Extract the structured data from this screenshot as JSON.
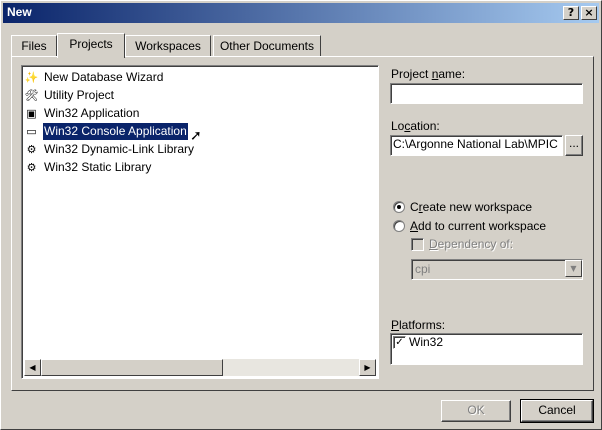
{
  "window": {
    "title": "New",
    "help_glyph": "?",
    "close_glyph": "×"
  },
  "tabs": [
    {
      "label": "Files",
      "active": false
    },
    {
      "label": "Projects",
      "active": true
    },
    {
      "label": "Workspaces",
      "active": false
    },
    {
      "label": "Other Documents",
      "active": false
    }
  ],
  "project_types": [
    {
      "label": "New Database Wizard",
      "icon": "wand-icon",
      "glyph": "✨",
      "selected": false
    },
    {
      "label": "Utility Project",
      "icon": "tools-icon",
      "glyph": "🛠",
      "selected": false
    },
    {
      "label": "Win32 Application",
      "icon": "window-app-icon",
      "glyph": "▣",
      "selected": false
    },
    {
      "label": "Win32 Console Application",
      "icon": "console-icon",
      "glyph": "▭",
      "selected": true
    },
    {
      "label": "Win32 Dynamic-Link Library",
      "icon": "dll-icon",
      "glyph": "⚙",
      "selected": false
    },
    {
      "label": "Win32 Static Library",
      "icon": "library-icon",
      "glyph": "⚙",
      "selected": false
    }
  ],
  "scroll": {
    "left_glyph": "◀",
    "right_glyph": "▶"
  },
  "form": {
    "project_name_label": "Project name:",
    "project_name_value": "",
    "location_label": "Location:",
    "location_value": "C:\\Argonne National Lab\\MPIC",
    "browse_label": "...",
    "create_workspace_label": "Create new workspace",
    "create_workspace_checked": true,
    "add_workspace_label": "Add to current workspace",
    "add_workspace_checked": false,
    "dependency_label": "Dependency of:",
    "dependency_value": "cpi",
    "platforms_label": "Platforms:",
    "platforms": [
      {
        "label": "Win32",
        "checked": true
      }
    ]
  },
  "buttons": {
    "ok": "OK",
    "cancel": "Cancel"
  }
}
